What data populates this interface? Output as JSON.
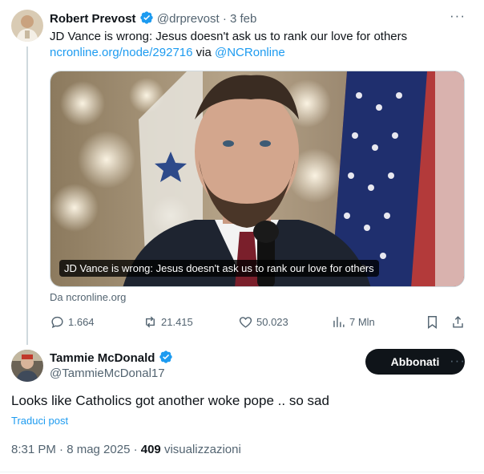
{
  "tweet1": {
    "author_name": "Robert Prevost",
    "handle": "@drprevost",
    "separator": "·",
    "date": "3 feb",
    "text": "JD Vance is wrong: Jesus doesn't ask us to rank our love for others",
    "link_text": "ncronline.org/node/292716",
    "via_text": " via ",
    "mention": "@NCRonline",
    "card_caption": "JD Vance is wrong: Jesus doesn't ask us to rank our love for others",
    "card_source": "Da ncronline.org",
    "replies": "1.664",
    "reposts": "21.415",
    "likes": "50.023",
    "views": "7 Mln"
  },
  "tweet2": {
    "author_name": "Tammie McDonald",
    "handle": "@TammieMcDonal17",
    "follow_label": "Abbonati",
    "text": "Looks like Catholics got another woke pope .. so sad",
    "translate_label": "Traduci post",
    "timestamp": "8:31 PM · 8 mag 2025 · ",
    "view_count": "409",
    "views_label": " visualizzazioni"
  },
  "colors": {
    "accent": "#1d9bf0",
    "text": "#0f1419",
    "muted": "#536471",
    "button": "#0f1419"
  }
}
